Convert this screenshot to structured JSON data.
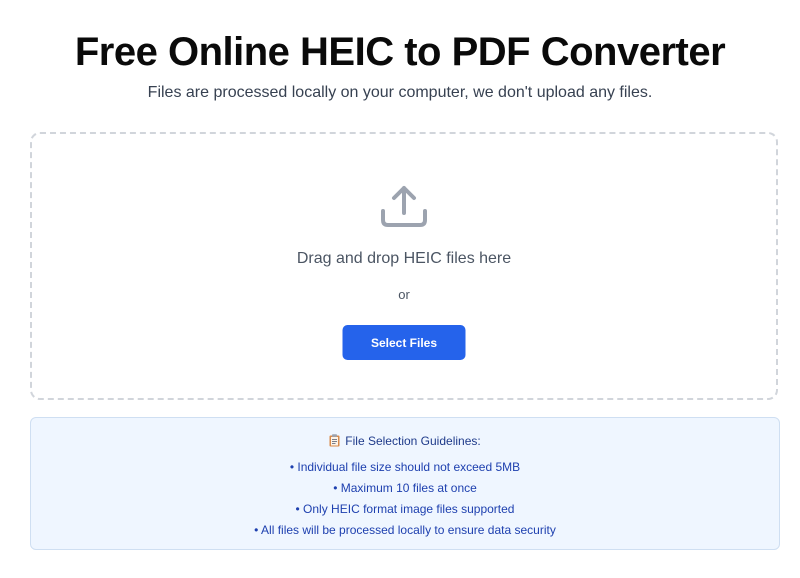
{
  "header": {
    "title": "Free Online HEIC to PDF Converter",
    "subtitle": "Files are processed locally on your computer, we don't upload any files."
  },
  "dropzone": {
    "icon": "upload-icon",
    "drag_text": "Drag and drop HEIC files here",
    "or_text": "or",
    "select_button_label": "Select Files"
  },
  "guidelines": {
    "icon": "clipboard-icon",
    "title": "File Selection Guidelines:",
    "items": [
      "• Individual file size should not exceed 5MB",
      "• Maximum 10 files at once",
      "• Only HEIC format image files supported",
      "• All files will be processed locally to ensure data security"
    ]
  },
  "colors": {
    "accent": "#2563eb",
    "guidelines_bg": "#eff6ff",
    "guidelines_text": "#1e40af"
  }
}
